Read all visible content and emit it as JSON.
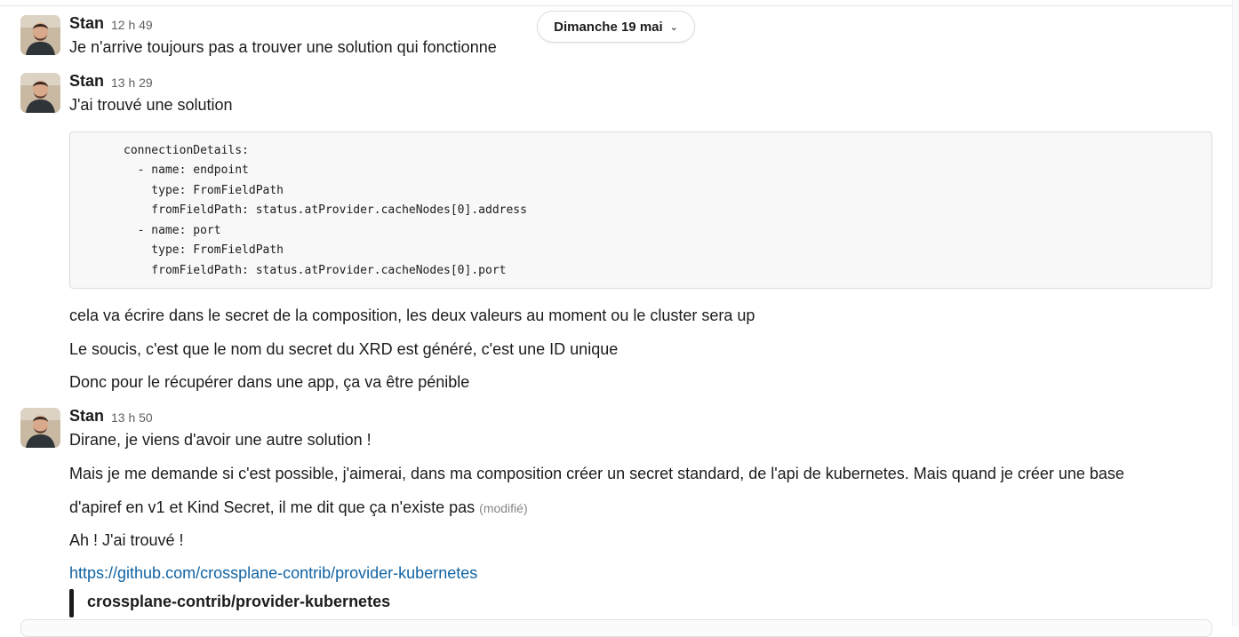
{
  "date_divider": {
    "label": "Dimanche 19 mai",
    "chevron": "chevron-down-icon"
  },
  "messages": [
    {
      "author": "Stan",
      "time": "12 h 49",
      "lines": [
        "Je n'arrive toujours pas a trouver une solution qui fonctionne"
      ]
    },
    {
      "author": "Stan",
      "time": "13 h 29",
      "lines": [
        "J'ai trouvé une solution"
      ]
    },
    {
      "author": "Stan",
      "time": "13 h 50",
      "lines": [
        "Dirane, je viens d'avoir une autre solution !"
      ]
    }
  ],
  "code_block": {
    "lines": [
      "connectionDetails:",
      "  - name: endpoint",
      "    type: FromFieldPath",
      "    fromFieldPath: status.atProvider.cacheNodes[0].address",
      "  - name: port",
      "    type: FromFieldPath",
      "    fromFieldPath: status.atProvider.cacheNodes[0].port"
    ]
  },
  "followups_1": [
    "cela va écrire dans le secret de la composition, les deux valeurs au moment ou le cluster sera up",
    "Le soucis, c'est que le nom du secret du XRD est généré, c'est une ID unique",
    "Donc pour le récupérer dans une app, ça va être pénible"
  ],
  "followups_3": [
    "Mais je me demande si c'est possible, j'aimerai, dans ma composition créer un secret standard, de l'api de kubernetes. Mais quand je créer une base",
    "d'apiref en v1 et Kind Secret, il me dit que ça n'existe pas",
    "Ah ! J'ai trouvé !"
  ],
  "edited_label": "(modifié)",
  "link": {
    "url": "https://github.com/crossplane-contrib/provider-kubernetes",
    "unfurl_title": "crossplane-contrib/provider-kubernetes"
  },
  "colors": {
    "link": "#1264a3",
    "text": "#1d1c1d",
    "muted": "#616061",
    "code_bg": "#f8f8f8"
  }
}
